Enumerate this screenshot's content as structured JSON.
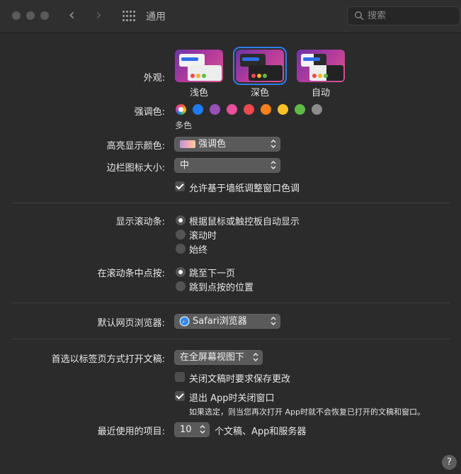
{
  "titlebar": {
    "title": "通用",
    "search": {
      "placeholder": "搜索",
      "value": ""
    }
  },
  "appearance": {
    "label": "外观:",
    "options": [
      {
        "label": "浅色",
        "selected": false
      },
      {
        "label": "深色",
        "selected": true
      },
      {
        "label": "自动",
        "selected": false
      }
    ]
  },
  "accent": {
    "label": "强调色:",
    "selected_name": "多色",
    "colors": [
      "multicolor",
      "#1e7cf2",
      "#9a50bb",
      "#e94f9a",
      "#f0484f",
      "#f7821b",
      "#fcc225",
      "#5fbb46",
      "#8c8c8c"
    ]
  },
  "highlight": {
    "label": "高亮显示颜色:",
    "value": "强调色"
  },
  "sidebar_icon": {
    "label": "边栏图标大小:",
    "value": "中"
  },
  "wallpaper_tint": {
    "label": "允许基于墙纸调整窗口色调",
    "checked": true
  },
  "scrollbars": {
    "label": "显示滚动条:",
    "options": [
      {
        "label": "根据鼠标或触控板自动显示",
        "selected": true
      },
      {
        "label": "滚动时",
        "selected": false
      },
      {
        "label": "始终",
        "selected": false
      }
    ]
  },
  "scroll_click": {
    "label": "在滚动条中点按:",
    "options": [
      {
        "label": "跳至下一页",
        "selected": true
      },
      {
        "label": "跳到点按的位置",
        "selected": false
      }
    ]
  },
  "browser": {
    "label": "默认网页浏览器:",
    "value": "Safari浏览器"
  },
  "tabs": {
    "label": "首选以标签页方式打开文稿:",
    "value": "在全屏幕视图下"
  },
  "ask_save": {
    "label": "关闭文稿时要求保存更改",
    "checked": false
  },
  "close_windows": {
    "label": "退出 App时关闭窗口",
    "checked": true,
    "note": "如果选定，则当您再次打开 App时就不会恢复已打开的文稿和窗口。"
  },
  "recent": {
    "label": "最近使用的项目:",
    "value": "10",
    "suffix": "个文稿、App和服务器"
  },
  "help": {
    "label": "?"
  }
}
